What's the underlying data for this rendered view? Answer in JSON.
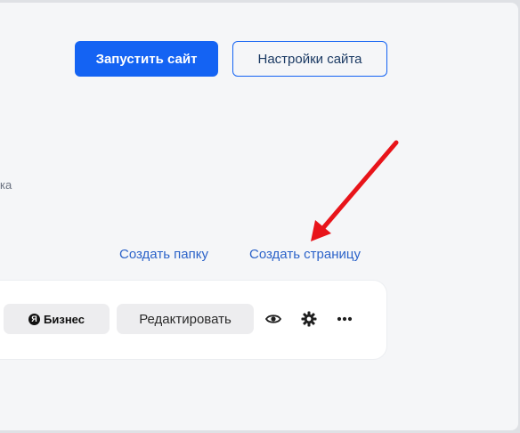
{
  "header": {
    "launch_button": "Запустить сайт",
    "settings_button": "Настройки сайта"
  },
  "partial_text": "ка",
  "actions": {
    "create_folder": "Создать папку",
    "create_page": "Создать страницу"
  },
  "page_card": {
    "badge_logo_letter": "Я",
    "badge_text": "Бизнес",
    "edit_button": "Редактировать",
    "icons": [
      "eye-icon",
      "gear-icon",
      "more-icon"
    ]
  },
  "colors": {
    "accent": "#1463f3",
    "link": "#2c63c9",
    "annotation_arrow": "#e8141a"
  }
}
